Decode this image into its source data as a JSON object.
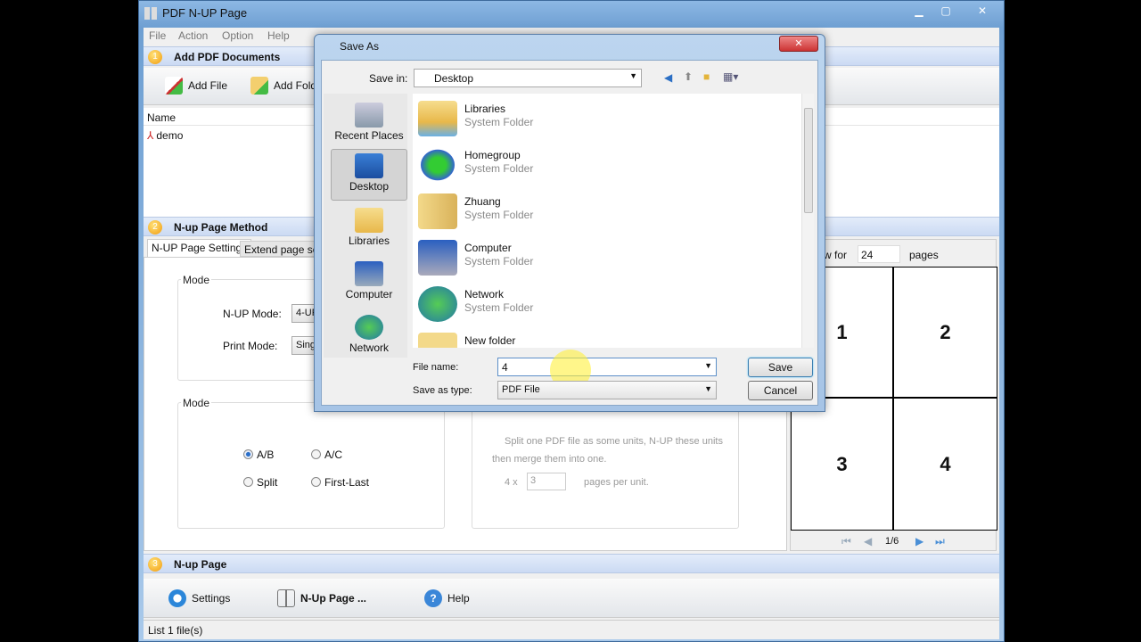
{
  "window": {
    "title": "PDF N-UP Page",
    "min": "▁",
    "max": "▢",
    "close": "✕"
  },
  "menu": [
    "File",
    "Action",
    "Option",
    "Help"
  ],
  "section1": {
    "num": "1",
    "title": "Add PDF Documents",
    "add_file": "Add File",
    "add_folder": "Add Folder",
    "col_name": "Name",
    "files": [
      "demo"
    ]
  },
  "section2": {
    "num": "2",
    "title": "N-up Page  Method",
    "tabs": [
      "N-UP Page Settings",
      "Extend page settings"
    ],
    "mode_group": "Mode",
    "nup_mode_label": "N-UP Mode:",
    "nup_mode_value": "4-UP",
    "print_mode_label": "Print Mode:",
    "print_mode_value": "Single",
    "mode2_group": "Mode",
    "radios": [
      {
        "label": "A/B",
        "checked": true
      },
      {
        "label": "A/C",
        "checked": false
      },
      {
        "label": "Split",
        "checked": false
      },
      {
        "label": "First-Last",
        "checked": false
      }
    ],
    "split_desc1": "Split one PDF file as some units, N-UP these units",
    "split_desc2": "then merge them into one.",
    "split_prefix": "4  x",
    "split_value": "3",
    "split_suffix": "pages per unit.",
    "preview_for": "w for",
    "preview_pages_value": "24",
    "preview_pages": "pages",
    "cells": [
      "1",
      "2",
      "3",
      "4"
    ],
    "page_indicator": "1/6"
  },
  "section3": {
    "num": "3",
    "title": "N-up Page",
    "settings": "Settings",
    "nup": "N-Up Page ...",
    "help": "Help"
  },
  "status": "List 1 file(s)",
  "dialog": {
    "title": "Save As",
    "close": "✕",
    "save_in_label": "Save in:",
    "save_in_value": "Desktop",
    "places": [
      "Recent Places",
      "Desktop",
      "Libraries",
      "Computer",
      "Network"
    ],
    "items": [
      {
        "name": "Libraries",
        "type": "System Folder"
      },
      {
        "name": "Homegroup",
        "type": "System Folder"
      },
      {
        "name": "Zhuang",
        "type": "System Folder"
      },
      {
        "name": "Computer",
        "type": "System Folder"
      },
      {
        "name": "Network",
        "type": "System Folder"
      },
      {
        "name": "New folder",
        "type": ""
      }
    ],
    "file_name_label": "File name:",
    "file_name_value": "4",
    "save_type_label": "Save as type:",
    "save_type_value": "PDF File",
    "save": "Save",
    "cancel": "Cancel"
  }
}
